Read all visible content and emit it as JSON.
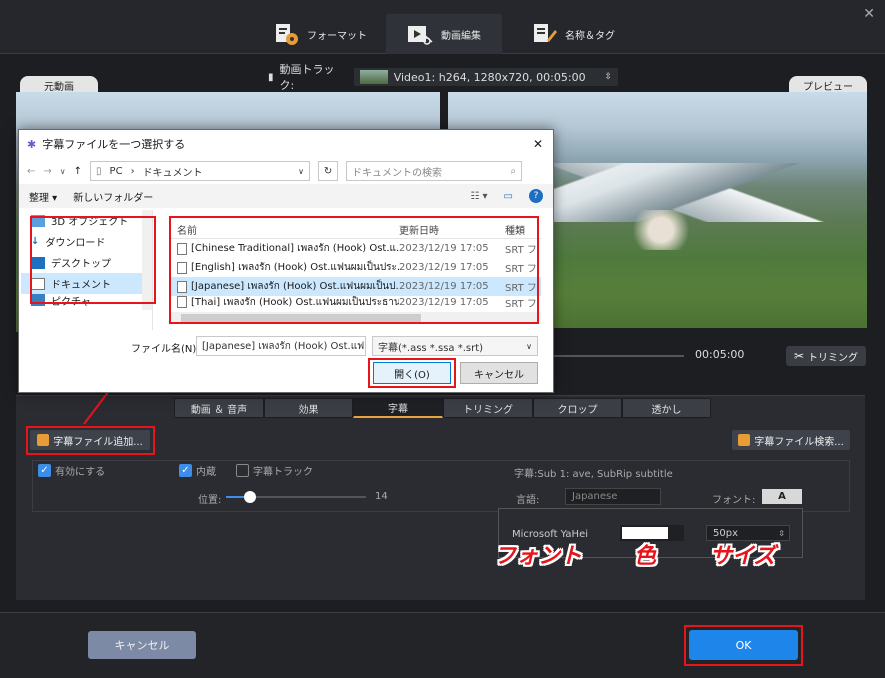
{
  "tabs": [
    {
      "label": "フォーマット"
    },
    {
      "label": "動画編集"
    },
    {
      "label": "名称＆タグ"
    }
  ],
  "original_label": "元動画",
  "preview_label": "プレビュー",
  "track": {
    "label": "動画トラック:",
    "value": "Video1: h264, 1280x720, 00:05:00"
  },
  "time": "00:05:00",
  "trim_button": "トリミング",
  "subtabs": [
    {
      "label": "動画 ＆ 音声"
    },
    {
      "label": "効果"
    },
    {
      "label": "字幕"
    },
    {
      "label": "トリミング"
    },
    {
      "label": "クロップ"
    },
    {
      "label": "透かし"
    }
  ],
  "add_subtitle_button": "字幕ファイル追加...",
  "search_subtitle_button": "字幕ファイル検索...",
  "enable_label": "有効にする",
  "embed_label": "内蔵",
  "subtitle_track_label": "字幕トラック",
  "subtitle_info": "字幕:Sub 1: ave, SubRip subtitle",
  "position_label": "位置:",
  "position_value": "14",
  "position_level": 0.17,
  "language_label": "言語:",
  "language_value": "Japanese",
  "font_label": "フォント:",
  "font_button": "A",
  "font_name": "Microsoft YaHei",
  "font_color": "#ffffff",
  "font_size": "50px",
  "annotations": {
    "font": "フォント",
    "color": "色",
    "size": "サイズ"
  },
  "cancel_button": "キャンセル",
  "ok_button": "OK",
  "dialog": {
    "title": "字幕ファイルを一つ選択する",
    "path": [
      "PC",
      "ドキュメント"
    ],
    "search_placeholder": "ドキュメントの検索",
    "organize": "整理 ▾",
    "new_folder": "新しいフォルダー",
    "nav": [
      {
        "label": "3D オブジェクト"
      },
      {
        "label": "ダウンロード"
      },
      {
        "label": "デスクトップ"
      },
      {
        "label": "ドキュメント"
      },
      {
        "label": "ピクチャ"
      }
    ],
    "columns": {
      "name": "名前",
      "date": "更新日時",
      "type": "種類"
    },
    "files": [
      {
        "name": "[Chinese Traditional] เพลงรัก (Hook) Ost.แ...",
        "date": "2023/12/19 17:05",
        "type": "SRT フ"
      },
      {
        "name": "[English] เพลงรัก (Hook) Ost.แฟนผมเป็นประ...",
        "date": "2023/12/19 17:05",
        "type": "SRT フ"
      },
      {
        "name": "[Japanese] เพลงรัก (Hook) Ost.แฟนผมเป็นป...",
        "date": "2023/12/19 17:05",
        "type": "SRT フ"
      },
      {
        "name": "[Thai] เพลงรัก (Hook) Ost.แฟนผมเป็นประธาน...",
        "date": "2023/12/19 17:05",
        "type": "SRT フ"
      }
    ],
    "filename_label": "ファイル名(N):",
    "filename_value": "[Japanese] เพลงรัก (Hook) Ost.แฟ",
    "filter": "字幕(*.ass *.ssa *.srt)",
    "open_button": "開く(O)",
    "cancel_button": "キャンセル"
  }
}
